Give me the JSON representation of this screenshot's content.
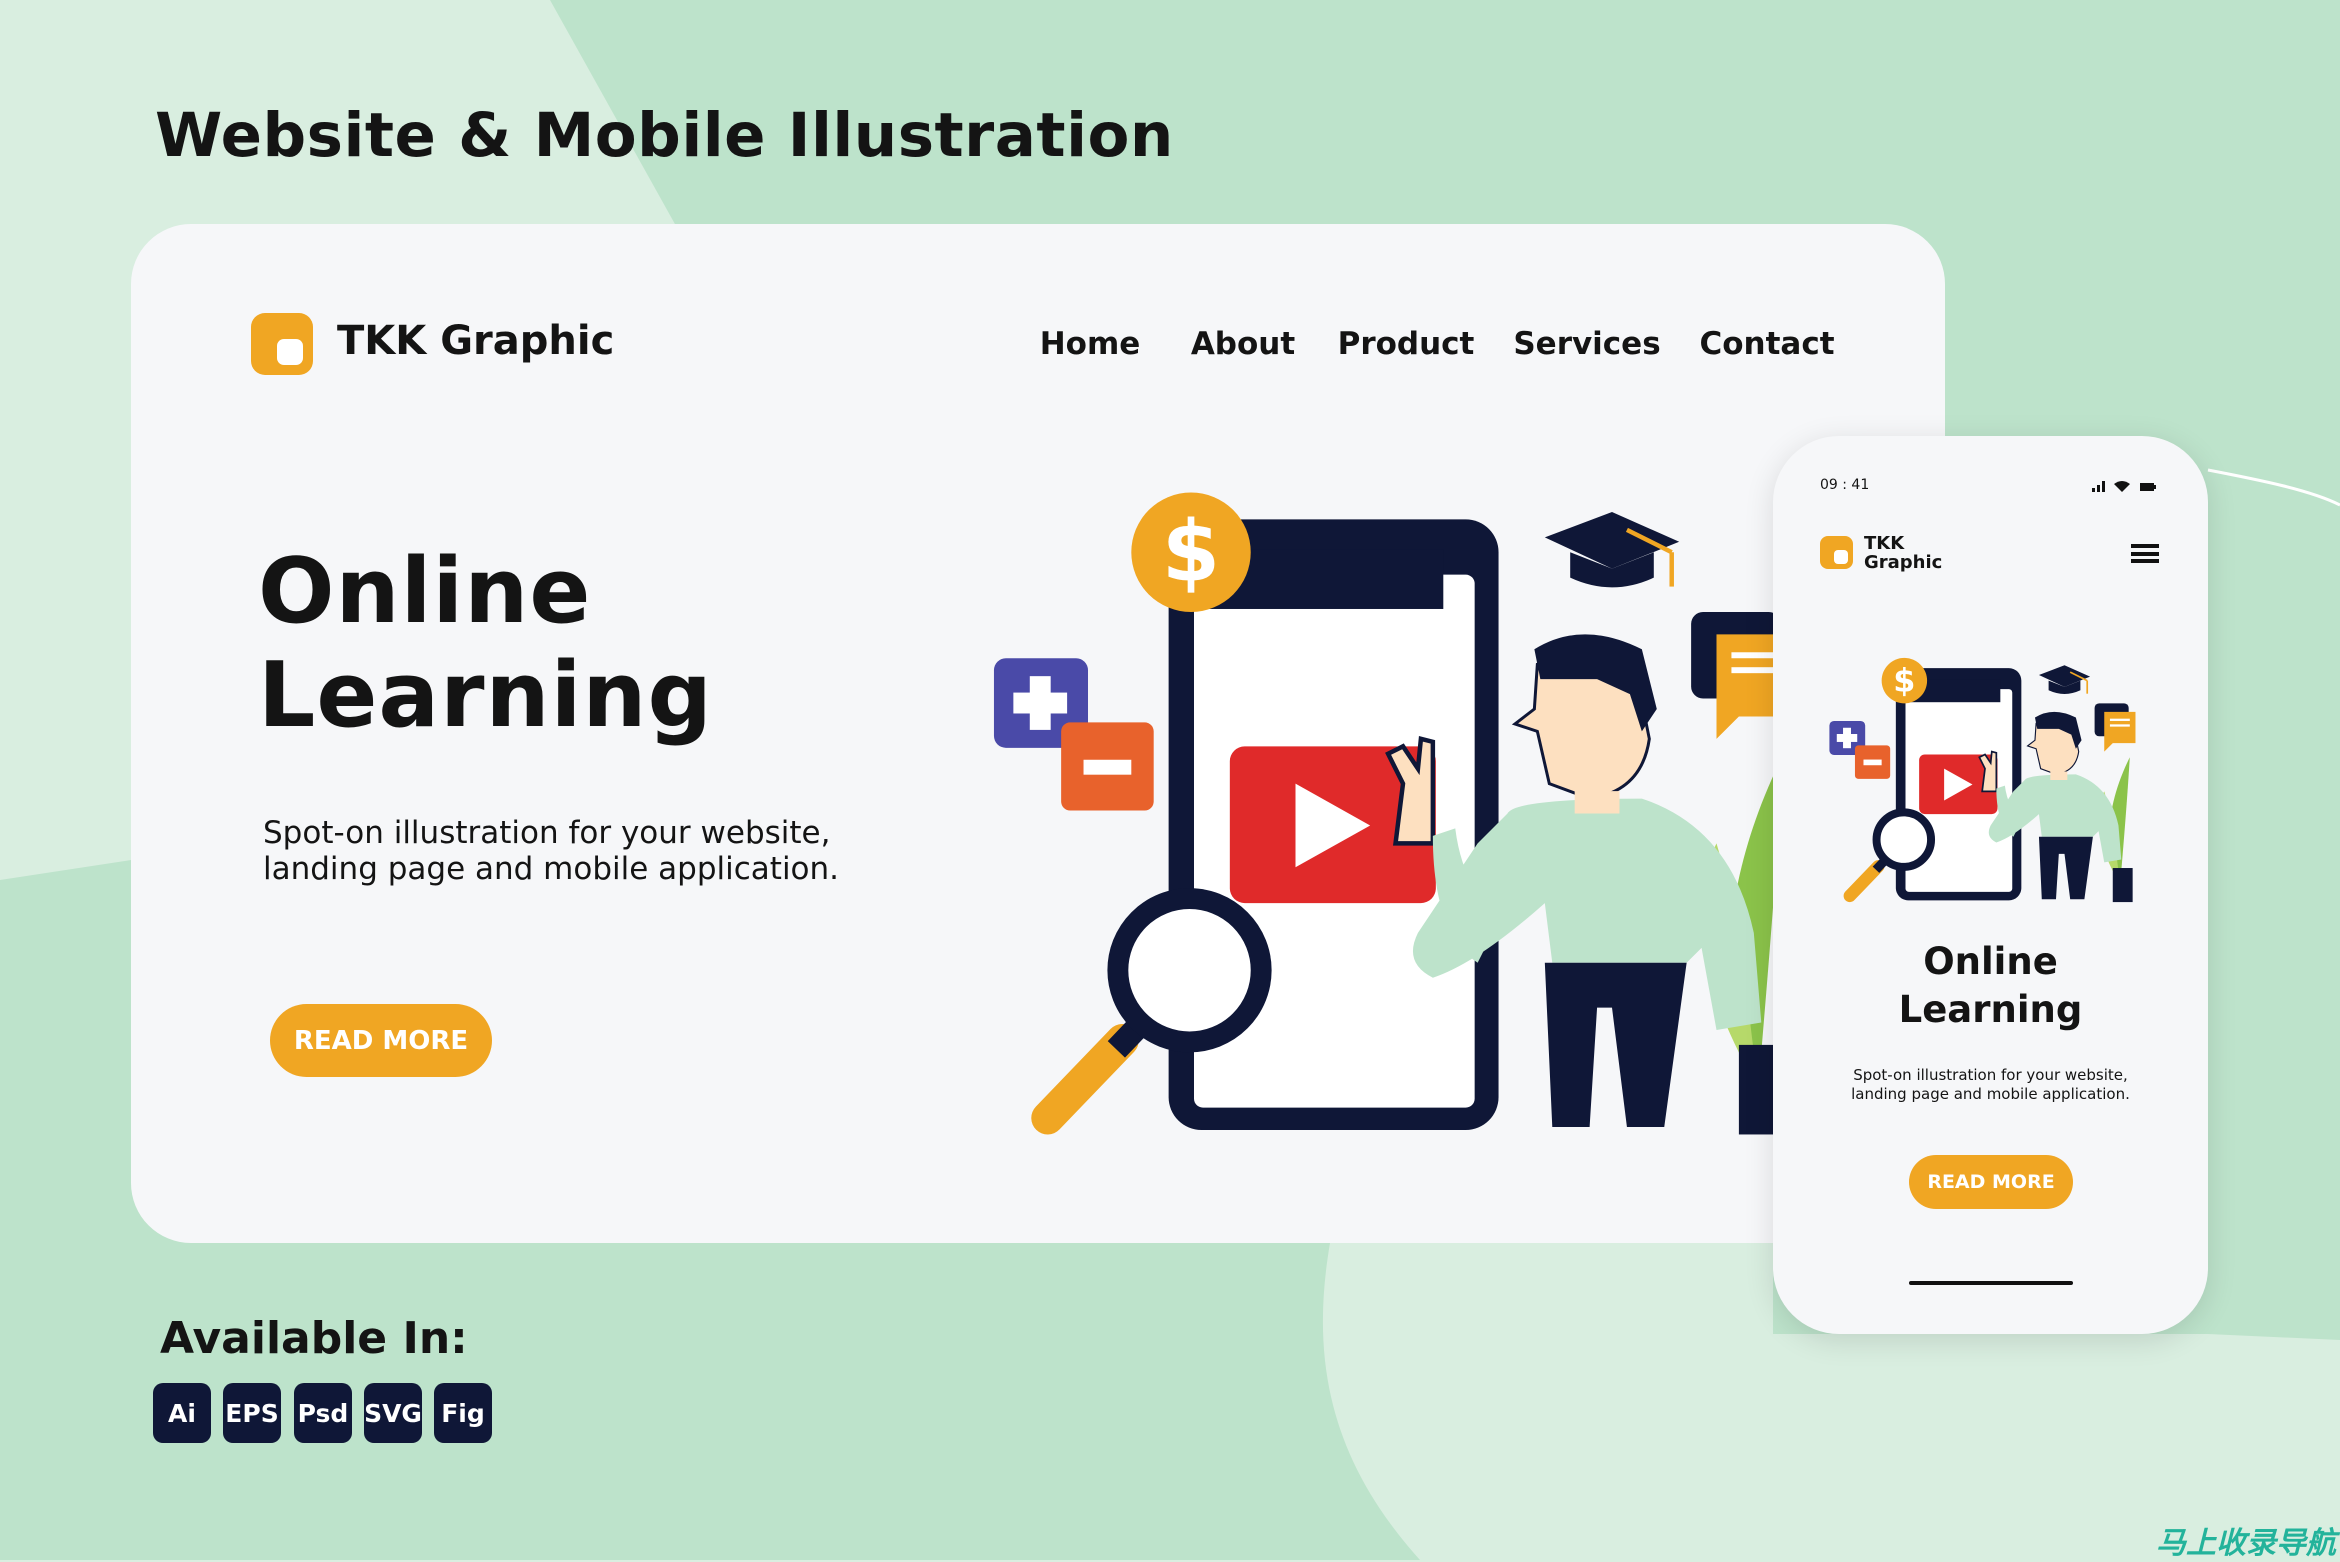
{
  "page_title": "Website & Mobile Illustration",
  "colors": {
    "accent": "#f0a623",
    "dark": "#0f1737",
    "mint": "#bde3cb",
    "background": "#d9eee0"
  },
  "desktop": {
    "brand": "TKK Graphic",
    "nav": [
      "Home",
      "About",
      "Product",
      "Services",
      "Contact"
    ],
    "headline_line1": "Online",
    "headline_line2": "Learning",
    "subtitle_line1": "Spot-on illustration for your website,",
    "subtitle_line2": "landing page and mobile application.",
    "cta": "READ MORE"
  },
  "mobile": {
    "time": "09 : 41",
    "brand_line1": "TKK",
    "brand_line2": "Graphic",
    "menu_icon": "hamburger-icon",
    "headline_line1": "Online",
    "headline_line2": "Learning",
    "subtitle_line1": "Spot-on illustration for your website,",
    "subtitle_line2": "landing page and mobile application.",
    "cta": "READ MORE"
  },
  "available": {
    "label": "Available In:",
    "formats": [
      "Ai",
      "EPS",
      "Psd",
      "SVG",
      "Fig"
    ]
  },
  "watermark": "马上收录导航"
}
